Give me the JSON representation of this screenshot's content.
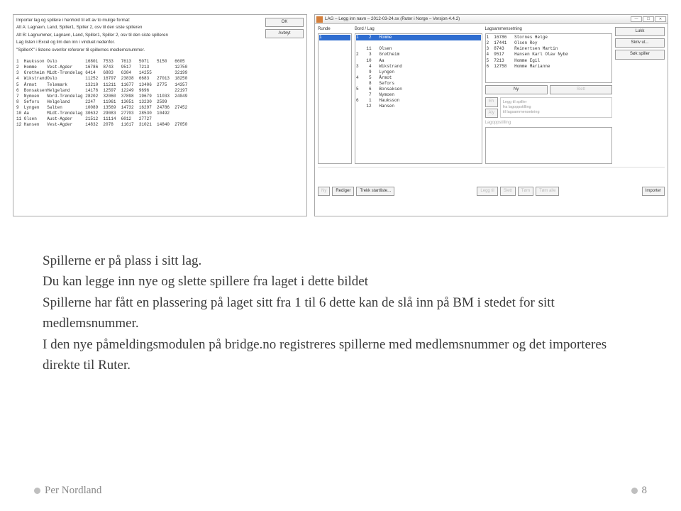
{
  "slide": {
    "paragraphs": [
      "Spillerne er på plass i sitt lag.",
      "Du kan legge inn nye og slette spillere fra laget i dette bildet",
      "Spillerne har fått en plassering på laget sitt fra 1 til 6 dette kan de slå inn på BM i stedet for sitt medlemsnummer.",
      "I den nye påmeldingsmodulen på bridge.no registreres spillerne med medlemsnummer og det importeres direkte til Ruter."
    ],
    "footer_author": "Per Nordland",
    "page_number": "8"
  },
  "win1": {
    "instructions": [
      "Importer lag og spillere i henhold til ett av to mulige format:",
      "Alt A: Lagnavn, Land, Spiller1, Spiller 2, osv til den siste spilleren",
      "Alt B: Lagnummer, Lagnavn, Land, Spiller1, Spiller 2, osv til den siste spilleren",
      "Lag listen i Excel og lim den inn i vinduet nedenfor.",
      "\"SpillerX\" i listene ovenfor refererer til spillernes medlemsnummer."
    ],
    "btn_ok": "OK",
    "btn_cancel": "Avbryt",
    "rows": [
      [
        "1",
        "Hauksson",
        "Oslo",
        "16801",
        "7533",
        "7613",
        "5071",
        "5150",
        "6605"
      ],
      [
        "2",
        "Homme",
        "Vest-Agder",
        "16786",
        "8743",
        "9517",
        "7213",
        "",
        "12750"
      ],
      [
        "3",
        "Grøtheim",
        "Midt-Trøndelag",
        "6414",
        "6883",
        "6384",
        "14255",
        "",
        "32199"
      ],
      [
        "4",
        "Wikstrand",
        "Oslo",
        "11252",
        "16797",
        "23838",
        "6683",
        "27013",
        "18250"
      ],
      [
        "5",
        "Årmot",
        "Telemark",
        "13210",
        "11211",
        "11677",
        "13406",
        "2775",
        "14357"
      ],
      [
        "6",
        "Bonsaksen",
        "Helgeland",
        "14176",
        "12597",
        "12249",
        "9696",
        "",
        "22197"
      ],
      [
        "7",
        "Nymoen",
        "Nord-Trøndelag",
        "28202",
        "32060",
        "37898",
        "19679",
        "11033",
        "24049"
      ],
      [
        "8",
        "Sefors",
        "Helgeland",
        "2247",
        "11961",
        "13051",
        "13230",
        "2599",
        ""
      ],
      [
        "9",
        "Lyngen",
        "Salten",
        "10089",
        "13569",
        "14732",
        "16297",
        "24786",
        "27452"
      ],
      [
        "10",
        "Aa",
        "Midt-Trøndelag",
        "30632",
        "29083",
        "27703",
        "28530",
        "10492",
        ""
      ],
      [
        "11",
        "Olsen",
        "Aust-Agder",
        "21512",
        "11114",
        "6012",
        "27727",
        "",
        ""
      ],
      [
        "12",
        "Hansen",
        "Vest-Agder",
        "14832",
        "2078",
        "11617",
        "31021",
        "14840",
        "27050"
      ]
    ]
  },
  "win2": {
    "title": "LAG – Legg inn navn – 2012-03-24.sx  (Ruter i Norge – Versjon 4.4.2)",
    "col_runde": "Runde",
    "col_bord": "Bord / Lag",
    "col_lag": "Lagsammensetning",
    "btn_lukk": "Lukk",
    "btn_skriv": "Skriv ut...",
    "btn_sok": "Søk spiller",
    "btn_ny": "Ny",
    "btn_slett": "Slett",
    "btn_eh": "Eh",
    "btn_aly": "Aly",
    "extra1": "Legg til spiller",
    "extra2": "fra lagoppstilling",
    "extra3": "til lagsammensetning",
    "label_lagoppstilling": "Lagoppstilling",
    "bottom": {
      "ny": "Ny",
      "rediger": "Rediger",
      "trekk": "Trekk startliste...",
      "leggtil": "Legg til",
      "slett": "Slett",
      "tom": "Tøm",
      "tomalle": "Tøm alle",
      "importer": "Importer"
    },
    "runde_rows": [
      "1"
    ],
    "bord_rows": [
      {
        "sel": true,
        "t": "1    2   Homme"
      },
      {
        "sel": false,
        "t": "    11   Olsen"
      },
      {
        "sel": false,
        "t": "2    3   Grøtheim"
      },
      {
        "sel": false,
        "t": "    10   Aa"
      },
      {
        "sel": false,
        "t": "3    4   Wikstrand"
      },
      {
        "sel": false,
        "t": "     9   Lyngen"
      },
      {
        "sel": false,
        "t": "4    5   Årmot"
      },
      {
        "sel": false,
        "t": "     8   Sefors"
      },
      {
        "sel": false,
        "t": "5    6   Bonsaksen"
      },
      {
        "sel": false,
        "t": "     7   Nymoen"
      },
      {
        "sel": false,
        "t": "6    1   Hauksson"
      },
      {
        "sel": false,
        "t": "    12   Hansen"
      }
    ],
    "lag_rows": [
      [
        "1",
        "16786",
        "Stornes Helge"
      ],
      [
        "2",
        "17441",
        "Olsen Roy"
      ],
      [
        "3",
        "8743",
        "Reinertsen Martin"
      ],
      [
        "4",
        "9517",
        "Hansen Karl Olav Nybø"
      ],
      [
        "5",
        "7213",
        "Homme Egil"
      ],
      [
        "6",
        "12758",
        "Homme Marianne"
      ]
    ]
  }
}
